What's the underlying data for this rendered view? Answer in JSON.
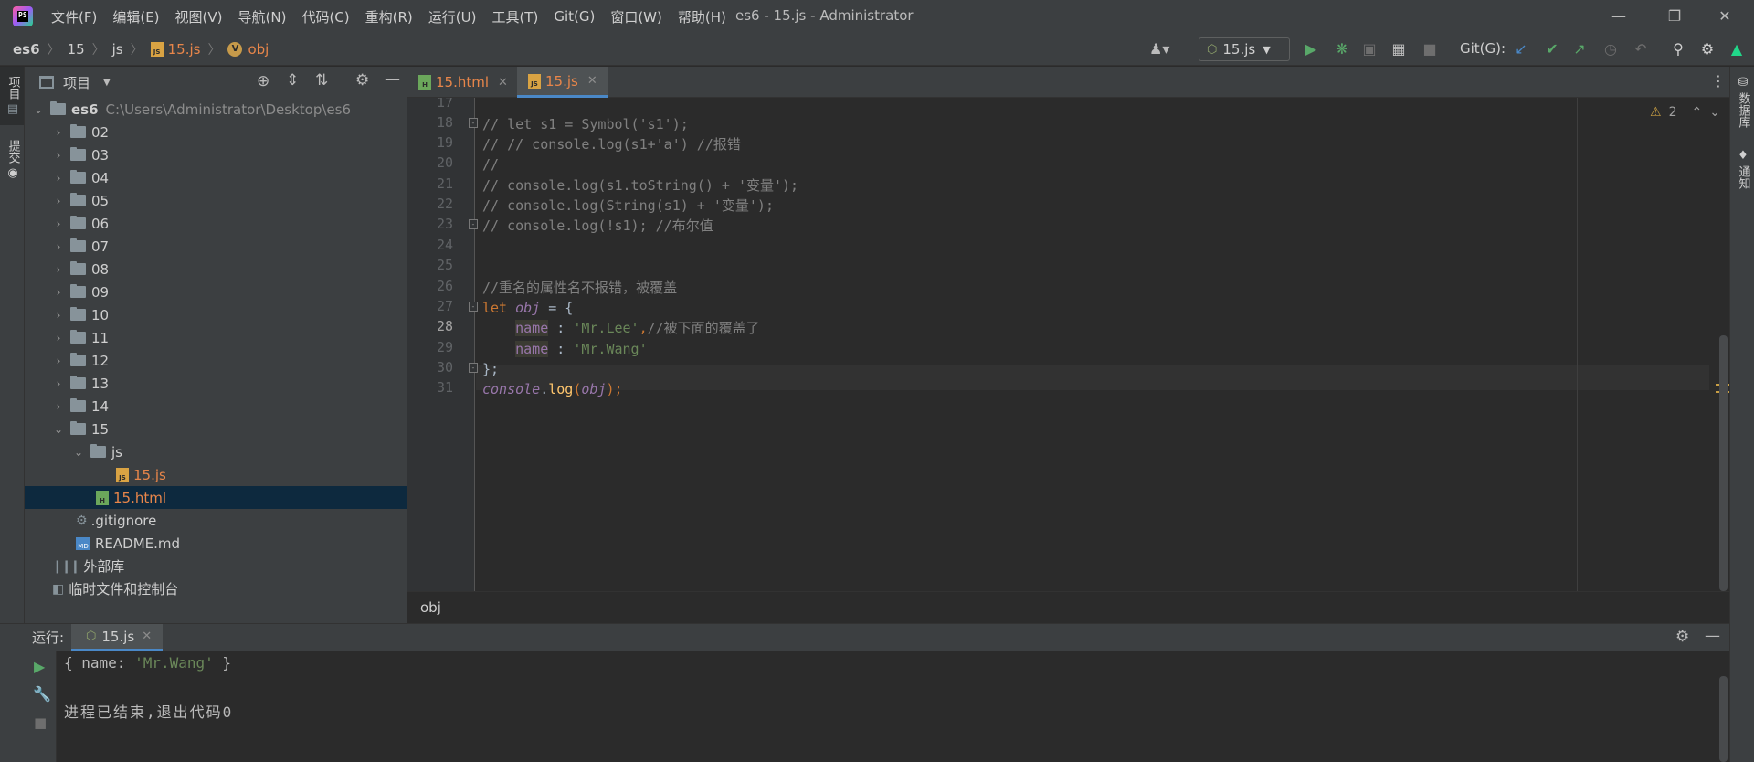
{
  "menu": {
    "items": [
      "文件(F)",
      "编辑(E)",
      "视图(V)",
      "导航(N)",
      "代码(C)",
      "重构(R)",
      "运行(U)",
      "工具(T)",
      "Git(G)",
      "窗口(W)",
      "帮助(H)"
    ]
  },
  "window": {
    "title": "es6 - 15.js - Administrator"
  },
  "breadcrumb": {
    "items": [
      "es6",
      "15",
      "js",
      "15.js",
      "obj"
    ]
  },
  "toolbar": {
    "run_config": "15.js",
    "git_label": "Git(G):"
  },
  "left_strip": {
    "project": "项目",
    "commit": "提交"
  },
  "right_strip": {
    "database": "数据库",
    "notifications": "通知"
  },
  "project_panel": {
    "title": "项目",
    "root_name": "es6",
    "root_path": "C:\\Users\\Administrator\\Desktop\\es6",
    "folders": [
      "02",
      "03",
      "04",
      "05",
      "06",
      "07",
      "08",
      "09",
      "10",
      "11",
      "12",
      "13",
      "14"
    ],
    "folder_15": "15",
    "folder_js": "js",
    "file_js": "15.js",
    "file_html": "15.html",
    "gitignore": ".gitignore",
    "readme": "README.md",
    "external_libs": "外部库",
    "scratches": "临时文件和控制台"
  },
  "editor_tabs": [
    {
      "label": "15.html",
      "active": false
    },
    {
      "label": "15.js",
      "active": true
    }
  ],
  "editor": {
    "warning_count": "2",
    "line_numbers": [
      "17",
      "18",
      "19",
      "20",
      "21",
      "22",
      "23",
      "24",
      "25",
      "26",
      "27",
      "28",
      "29",
      "30",
      "31"
    ],
    "current_line": "28",
    "lines": {
      "l18": "// let s1 = Symbol('s1');",
      "l19": "// // console.log(s1+'a') //报错",
      "l20": "//",
      "l21": "// console.log(s1.toString() + '变量');",
      "l22": "// console.log(String(s1) + '变量');",
      "l23": "// console.log(!s1); //布尔值",
      "l26": "//重名的属性名不报错，被覆盖",
      "l27_kw": "let",
      "l27_var": "obj",
      "l27_rest": " = {",
      "l28_indent": "    ",
      "l28_prop": "name",
      "l28_colon": " : ",
      "l28_str": "'Mr.Lee'",
      "l28_comma": ",",
      "l28_comment": "//被下面的覆盖了",
      "l29_indent": "    ",
      "l29_prop": "name",
      "l29_colon": " : ",
      "l29_str": "'Mr.Wang'",
      "l30": "};",
      "l31_obj": "console",
      "l31_dot": ".",
      "l31_method": "log",
      "l31_open": "(",
      "l31_arg": "obj",
      "l31_close": ");"
    }
  },
  "editor_breadcrumb": "obj",
  "run_panel": {
    "label": "运行:",
    "tab": "15.js",
    "output_line1_pre": "{ name: ",
    "output_line1_str": "'Mr.Wang'",
    "output_line1_post": " }",
    "output_line2": "进程已结束,退出代码0"
  }
}
